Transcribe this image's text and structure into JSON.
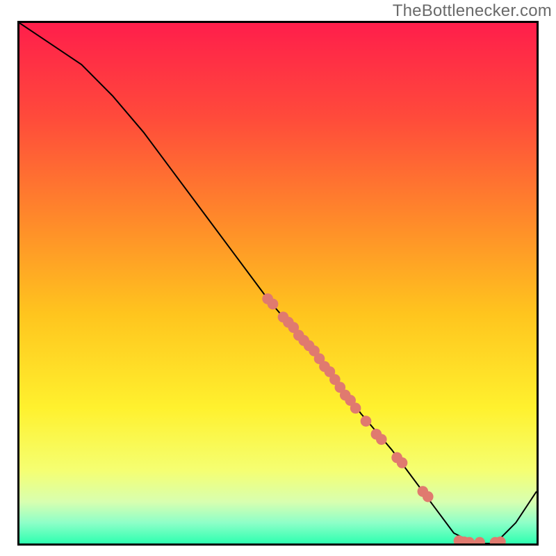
{
  "watermark": "TheBottlenecker.com",
  "chart_data": {
    "type": "line",
    "title": "",
    "xlabel": "",
    "ylabel": "",
    "xlim": [
      0,
      100
    ],
    "ylim": [
      0,
      100
    ],
    "grid": false,
    "legend": false,
    "series": [
      {
        "name": "bottleneck-curve",
        "x": [
          0,
          6,
          12,
          18,
          24,
          30,
          36,
          42,
          48,
          54,
          60,
          66,
          72,
          78,
          84,
          88,
          92,
          96,
          100
        ],
        "y": [
          100,
          96,
          92,
          86,
          79,
          71,
          63,
          55,
          47,
          40,
          33,
          25,
          18,
          10,
          2,
          0,
          0,
          4,
          10
        ]
      }
    ],
    "points": {
      "name": "sample-points",
      "color": "#e07a6f",
      "xy": [
        [
          48,
          47
        ],
        [
          49,
          46
        ],
        [
          51,
          43.5
        ],
        [
          52,
          42.5
        ],
        [
          53,
          41.5
        ],
        [
          54,
          40
        ],
        [
          55,
          39
        ],
        [
          56,
          38
        ],
        [
          57,
          37
        ],
        [
          58,
          35.5
        ],
        [
          59,
          34
        ],
        [
          60,
          33
        ],
        [
          61,
          31.5
        ],
        [
          62,
          30
        ],
        [
          63,
          28.5
        ],
        [
          64,
          27.5
        ],
        [
          65,
          26
        ],
        [
          67,
          23.5
        ],
        [
          69,
          21
        ],
        [
          70,
          20
        ],
        [
          73,
          16.5
        ],
        [
          74,
          15.5
        ],
        [
          78,
          10
        ],
        [
          79,
          9
        ],
        [
          85,
          0.5
        ],
        [
          86,
          0.3
        ],
        [
          87,
          0.2
        ],
        [
          89,
          0.2
        ],
        [
          92,
          0.2
        ],
        [
          93,
          0.3
        ]
      ]
    },
    "gradient_stops": [
      {
        "offset": 0.0,
        "color": "#ff1e4b"
      },
      {
        "offset": 0.18,
        "color": "#ff4a3b"
      },
      {
        "offset": 0.38,
        "color": "#ff8a2a"
      },
      {
        "offset": 0.56,
        "color": "#ffc51e"
      },
      {
        "offset": 0.74,
        "color": "#fff12e"
      },
      {
        "offset": 0.86,
        "color": "#f5ff72"
      },
      {
        "offset": 0.92,
        "color": "#d8ffb0"
      },
      {
        "offset": 0.96,
        "color": "#8effc8"
      },
      {
        "offset": 1.0,
        "color": "#2effb0"
      }
    ]
  }
}
